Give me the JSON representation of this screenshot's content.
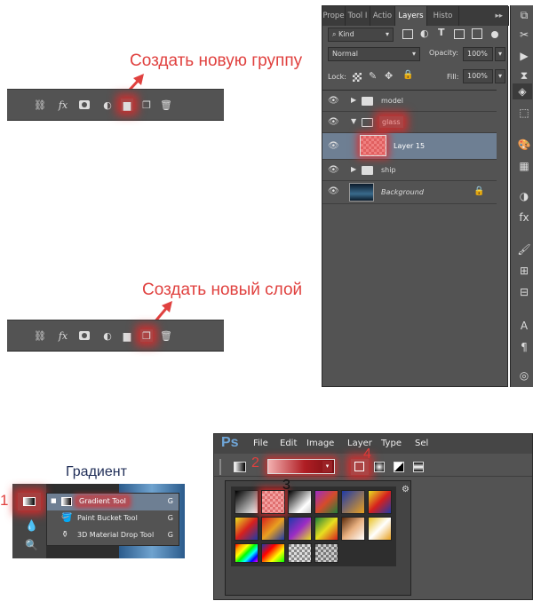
{
  "annotations": {
    "new_group": "Создать новую группу",
    "new_layer": "Создать новый слой",
    "gradient_title": "Градиент",
    "step1": "1",
    "step2": "2",
    "step3": "3",
    "step4": "4"
  },
  "layers_panel": {
    "tabs": [
      "Prope",
      "Tool I",
      "Actio",
      "Layers",
      "Histo"
    ],
    "active_tab": "Layers",
    "menu_glyph": "▸▸",
    "kind_label": "Kind",
    "blend_mode": "Normal",
    "opacity_label": "Opacity:",
    "opacity_value": "100%",
    "lock_label": "Lock:",
    "fill_label": "Fill:",
    "fill_value": "100%",
    "layers": [
      {
        "name": "model",
        "type": "folder",
        "expanded": false
      },
      {
        "name": "glass",
        "type": "folder",
        "expanded": true
      },
      {
        "name": "Layer 15",
        "type": "layer",
        "selected": true
      },
      {
        "name": "ship",
        "type": "folder",
        "expanded": false
      },
      {
        "name": "Background",
        "type": "background",
        "locked": true
      }
    ]
  },
  "tool_flyout": {
    "items": [
      {
        "label": "Gradient Tool",
        "shortcut": "G",
        "active": true
      },
      {
        "label": "Paint Bucket Tool",
        "shortcut": "G",
        "active": false
      },
      {
        "label": "3D Material Drop Tool",
        "shortcut": "G",
        "active": false
      }
    ]
  },
  "ps_window": {
    "logo": "Ps",
    "menu": [
      "File",
      "Edit",
      "Image",
      "Layer",
      "Type",
      "Sel"
    ]
  },
  "colors": {
    "accent_red": "#e0413f",
    "panel_bg": "#535353",
    "selected_row": "#6e7f93"
  }
}
